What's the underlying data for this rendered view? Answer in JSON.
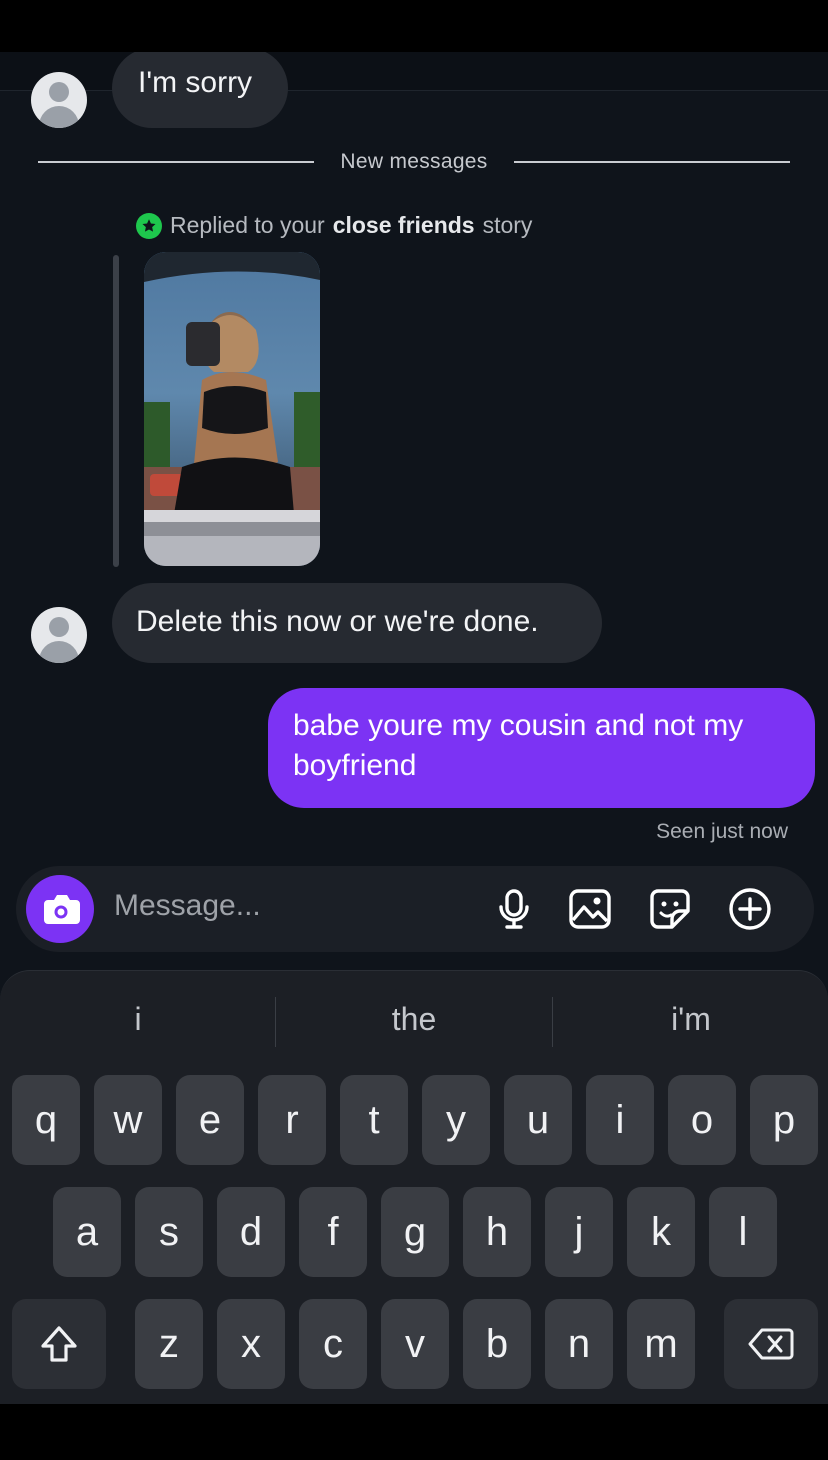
{
  "conversation": {
    "prev_message": "I'm sorry",
    "new_messages_label": "New messages",
    "reply_prefix": "Replied to your",
    "reply_bold": "close friends",
    "reply_suffix": "story",
    "incoming_message": "Delete this now or we're done.",
    "outgoing_message": "babe youre my cousin and not my boyfriend",
    "seen_status": "Seen just now"
  },
  "composer": {
    "placeholder": "Message...",
    "icons": [
      "camera-icon",
      "microphone-icon",
      "gallery-icon",
      "sticker-icon",
      "add-icon"
    ]
  },
  "keyboard": {
    "suggestions": [
      "i",
      "the",
      "i'm"
    ],
    "row1": [
      "q",
      "w",
      "e",
      "r",
      "t",
      "y",
      "u",
      "i",
      "o",
      "p"
    ],
    "row2": [
      "a",
      "s",
      "d",
      "f",
      "g",
      "h",
      "j",
      "k",
      "l"
    ],
    "row3": [
      "z",
      "x",
      "c",
      "v",
      "b",
      "n",
      "m"
    ]
  },
  "colors": {
    "background": "#0f141b",
    "outgoing_bubble": "#7c33f4",
    "incoming_bubble": "#262a31",
    "close_friends_badge": "#1ec74d"
  }
}
